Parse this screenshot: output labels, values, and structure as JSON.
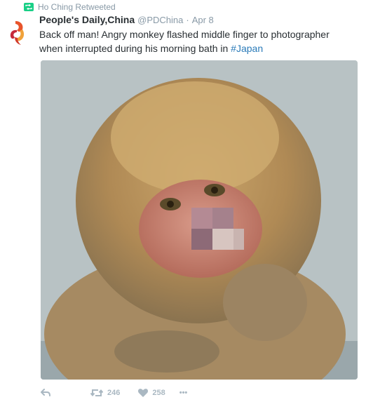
{
  "retweet_context": {
    "text": "Ho Ching Retweeted"
  },
  "tweet": {
    "display_name": "People's Daily,China",
    "handle": "@PDChina",
    "separator": "·",
    "timestamp": "Apr 8",
    "text_main": "Back off man! Angry monkey flashed middle finger to photographer when interrupted during his morning bath in ",
    "hashtag": "#Japan"
  },
  "actions": {
    "retweet_count": "246",
    "like_count": "258",
    "more_label": "•••"
  },
  "colors": {
    "retweet_green": "#19cf86",
    "hashtag_blue": "#2b7bb9",
    "muted_gray": "#8899a6",
    "icon_gray": "#aab8c2",
    "text_dark": "#292f33"
  }
}
